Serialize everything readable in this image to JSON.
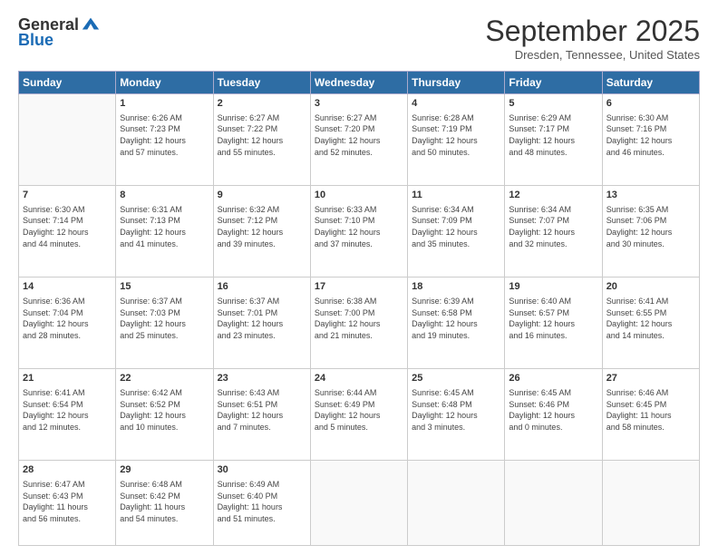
{
  "header": {
    "logo_line1": "General",
    "logo_line2": "Blue",
    "month_title": "September 2025",
    "location": "Dresden, Tennessee, United States"
  },
  "days_of_week": [
    "Sunday",
    "Monday",
    "Tuesday",
    "Wednesday",
    "Thursday",
    "Friday",
    "Saturday"
  ],
  "weeks": [
    [
      {
        "day": "",
        "info": ""
      },
      {
        "day": "1",
        "info": "Sunrise: 6:26 AM\nSunset: 7:23 PM\nDaylight: 12 hours\nand 57 minutes."
      },
      {
        "day": "2",
        "info": "Sunrise: 6:27 AM\nSunset: 7:22 PM\nDaylight: 12 hours\nand 55 minutes."
      },
      {
        "day": "3",
        "info": "Sunrise: 6:27 AM\nSunset: 7:20 PM\nDaylight: 12 hours\nand 52 minutes."
      },
      {
        "day": "4",
        "info": "Sunrise: 6:28 AM\nSunset: 7:19 PM\nDaylight: 12 hours\nand 50 minutes."
      },
      {
        "day": "5",
        "info": "Sunrise: 6:29 AM\nSunset: 7:17 PM\nDaylight: 12 hours\nand 48 minutes."
      },
      {
        "day": "6",
        "info": "Sunrise: 6:30 AM\nSunset: 7:16 PM\nDaylight: 12 hours\nand 46 minutes."
      }
    ],
    [
      {
        "day": "7",
        "info": "Sunrise: 6:30 AM\nSunset: 7:14 PM\nDaylight: 12 hours\nand 44 minutes."
      },
      {
        "day": "8",
        "info": "Sunrise: 6:31 AM\nSunset: 7:13 PM\nDaylight: 12 hours\nand 41 minutes."
      },
      {
        "day": "9",
        "info": "Sunrise: 6:32 AM\nSunset: 7:12 PM\nDaylight: 12 hours\nand 39 minutes."
      },
      {
        "day": "10",
        "info": "Sunrise: 6:33 AM\nSunset: 7:10 PM\nDaylight: 12 hours\nand 37 minutes."
      },
      {
        "day": "11",
        "info": "Sunrise: 6:34 AM\nSunset: 7:09 PM\nDaylight: 12 hours\nand 35 minutes."
      },
      {
        "day": "12",
        "info": "Sunrise: 6:34 AM\nSunset: 7:07 PM\nDaylight: 12 hours\nand 32 minutes."
      },
      {
        "day": "13",
        "info": "Sunrise: 6:35 AM\nSunset: 7:06 PM\nDaylight: 12 hours\nand 30 minutes."
      }
    ],
    [
      {
        "day": "14",
        "info": "Sunrise: 6:36 AM\nSunset: 7:04 PM\nDaylight: 12 hours\nand 28 minutes."
      },
      {
        "day": "15",
        "info": "Sunrise: 6:37 AM\nSunset: 7:03 PM\nDaylight: 12 hours\nand 25 minutes."
      },
      {
        "day": "16",
        "info": "Sunrise: 6:37 AM\nSunset: 7:01 PM\nDaylight: 12 hours\nand 23 minutes."
      },
      {
        "day": "17",
        "info": "Sunrise: 6:38 AM\nSunset: 7:00 PM\nDaylight: 12 hours\nand 21 minutes."
      },
      {
        "day": "18",
        "info": "Sunrise: 6:39 AM\nSunset: 6:58 PM\nDaylight: 12 hours\nand 19 minutes."
      },
      {
        "day": "19",
        "info": "Sunrise: 6:40 AM\nSunset: 6:57 PM\nDaylight: 12 hours\nand 16 minutes."
      },
      {
        "day": "20",
        "info": "Sunrise: 6:41 AM\nSunset: 6:55 PM\nDaylight: 12 hours\nand 14 minutes."
      }
    ],
    [
      {
        "day": "21",
        "info": "Sunrise: 6:41 AM\nSunset: 6:54 PM\nDaylight: 12 hours\nand 12 minutes."
      },
      {
        "day": "22",
        "info": "Sunrise: 6:42 AM\nSunset: 6:52 PM\nDaylight: 12 hours\nand 10 minutes."
      },
      {
        "day": "23",
        "info": "Sunrise: 6:43 AM\nSunset: 6:51 PM\nDaylight: 12 hours\nand 7 minutes."
      },
      {
        "day": "24",
        "info": "Sunrise: 6:44 AM\nSunset: 6:49 PM\nDaylight: 12 hours\nand 5 minutes."
      },
      {
        "day": "25",
        "info": "Sunrise: 6:45 AM\nSunset: 6:48 PM\nDaylight: 12 hours\nand 3 minutes."
      },
      {
        "day": "26",
        "info": "Sunrise: 6:45 AM\nSunset: 6:46 PM\nDaylight: 12 hours\nand 0 minutes."
      },
      {
        "day": "27",
        "info": "Sunrise: 6:46 AM\nSunset: 6:45 PM\nDaylight: 11 hours\nand 58 minutes."
      }
    ],
    [
      {
        "day": "28",
        "info": "Sunrise: 6:47 AM\nSunset: 6:43 PM\nDaylight: 11 hours\nand 56 minutes."
      },
      {
        "day": "29",
        "info": "Sunrise: 6:48 AM\nSunset: 6:42 PM\nDaylight: 11 hours\nand 54 minutes."
      },
      {
        "day": "30",
        "info": "Sunrise: 6:49 AM\nSunset: 6:40 PM\nDaylight: 11 hours\nand 51 minutes."
      },
      {
        "day": "",
        "info": ""
      },
      {
        "day": "",
        "info": ""
      },
      {
        "day": "",
        "info": ""
      },
      {
        "day": "",
        "info": ""
      }
    ]
  ]
}
